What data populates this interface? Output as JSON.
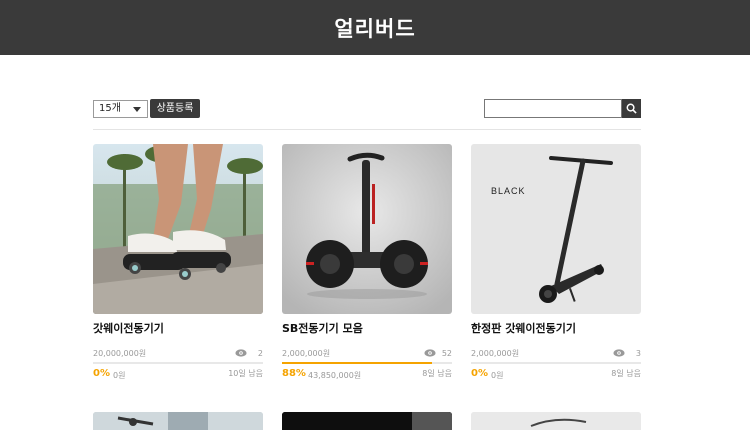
{
  "header": {
    "title": "얼리버드"
  },
  "toolbar": {
    "page_size_selected": "15개",
    "register_label": "상품등록",
    "search_placeholder": ""
  },
  "colors": {
    "topbar": "#3a3a3a",
    "accent": "#f5a300"
  },
  "products": [
    {
      "name": "갓웨이전동기기",
      "target": "20,000,000원",
      "views": "2",
      "percent_text": "0%",
      "progress": 0,
      "amount": "0원",
      "days_left": "10일 남음"
    },
    {
      "name": "SB전동기기 모음",
      "target": "2,000,000원",
      "views": "52",
      "percent_text": "88%",
      "progress": 88,
      "amount": "43,850,000원",
      "days_left": "8일 남음"
    },
    {
      "name": "한정판 갓웨이전동기기",
      "target": "2,000,000원",
      "views": "3",
      "percent_text": "0%",
      "progress": 0,
      "amount": "0원",
      "days_left": "8일 남음",
      "image_text": "BLACK"
    }
  ]
}
